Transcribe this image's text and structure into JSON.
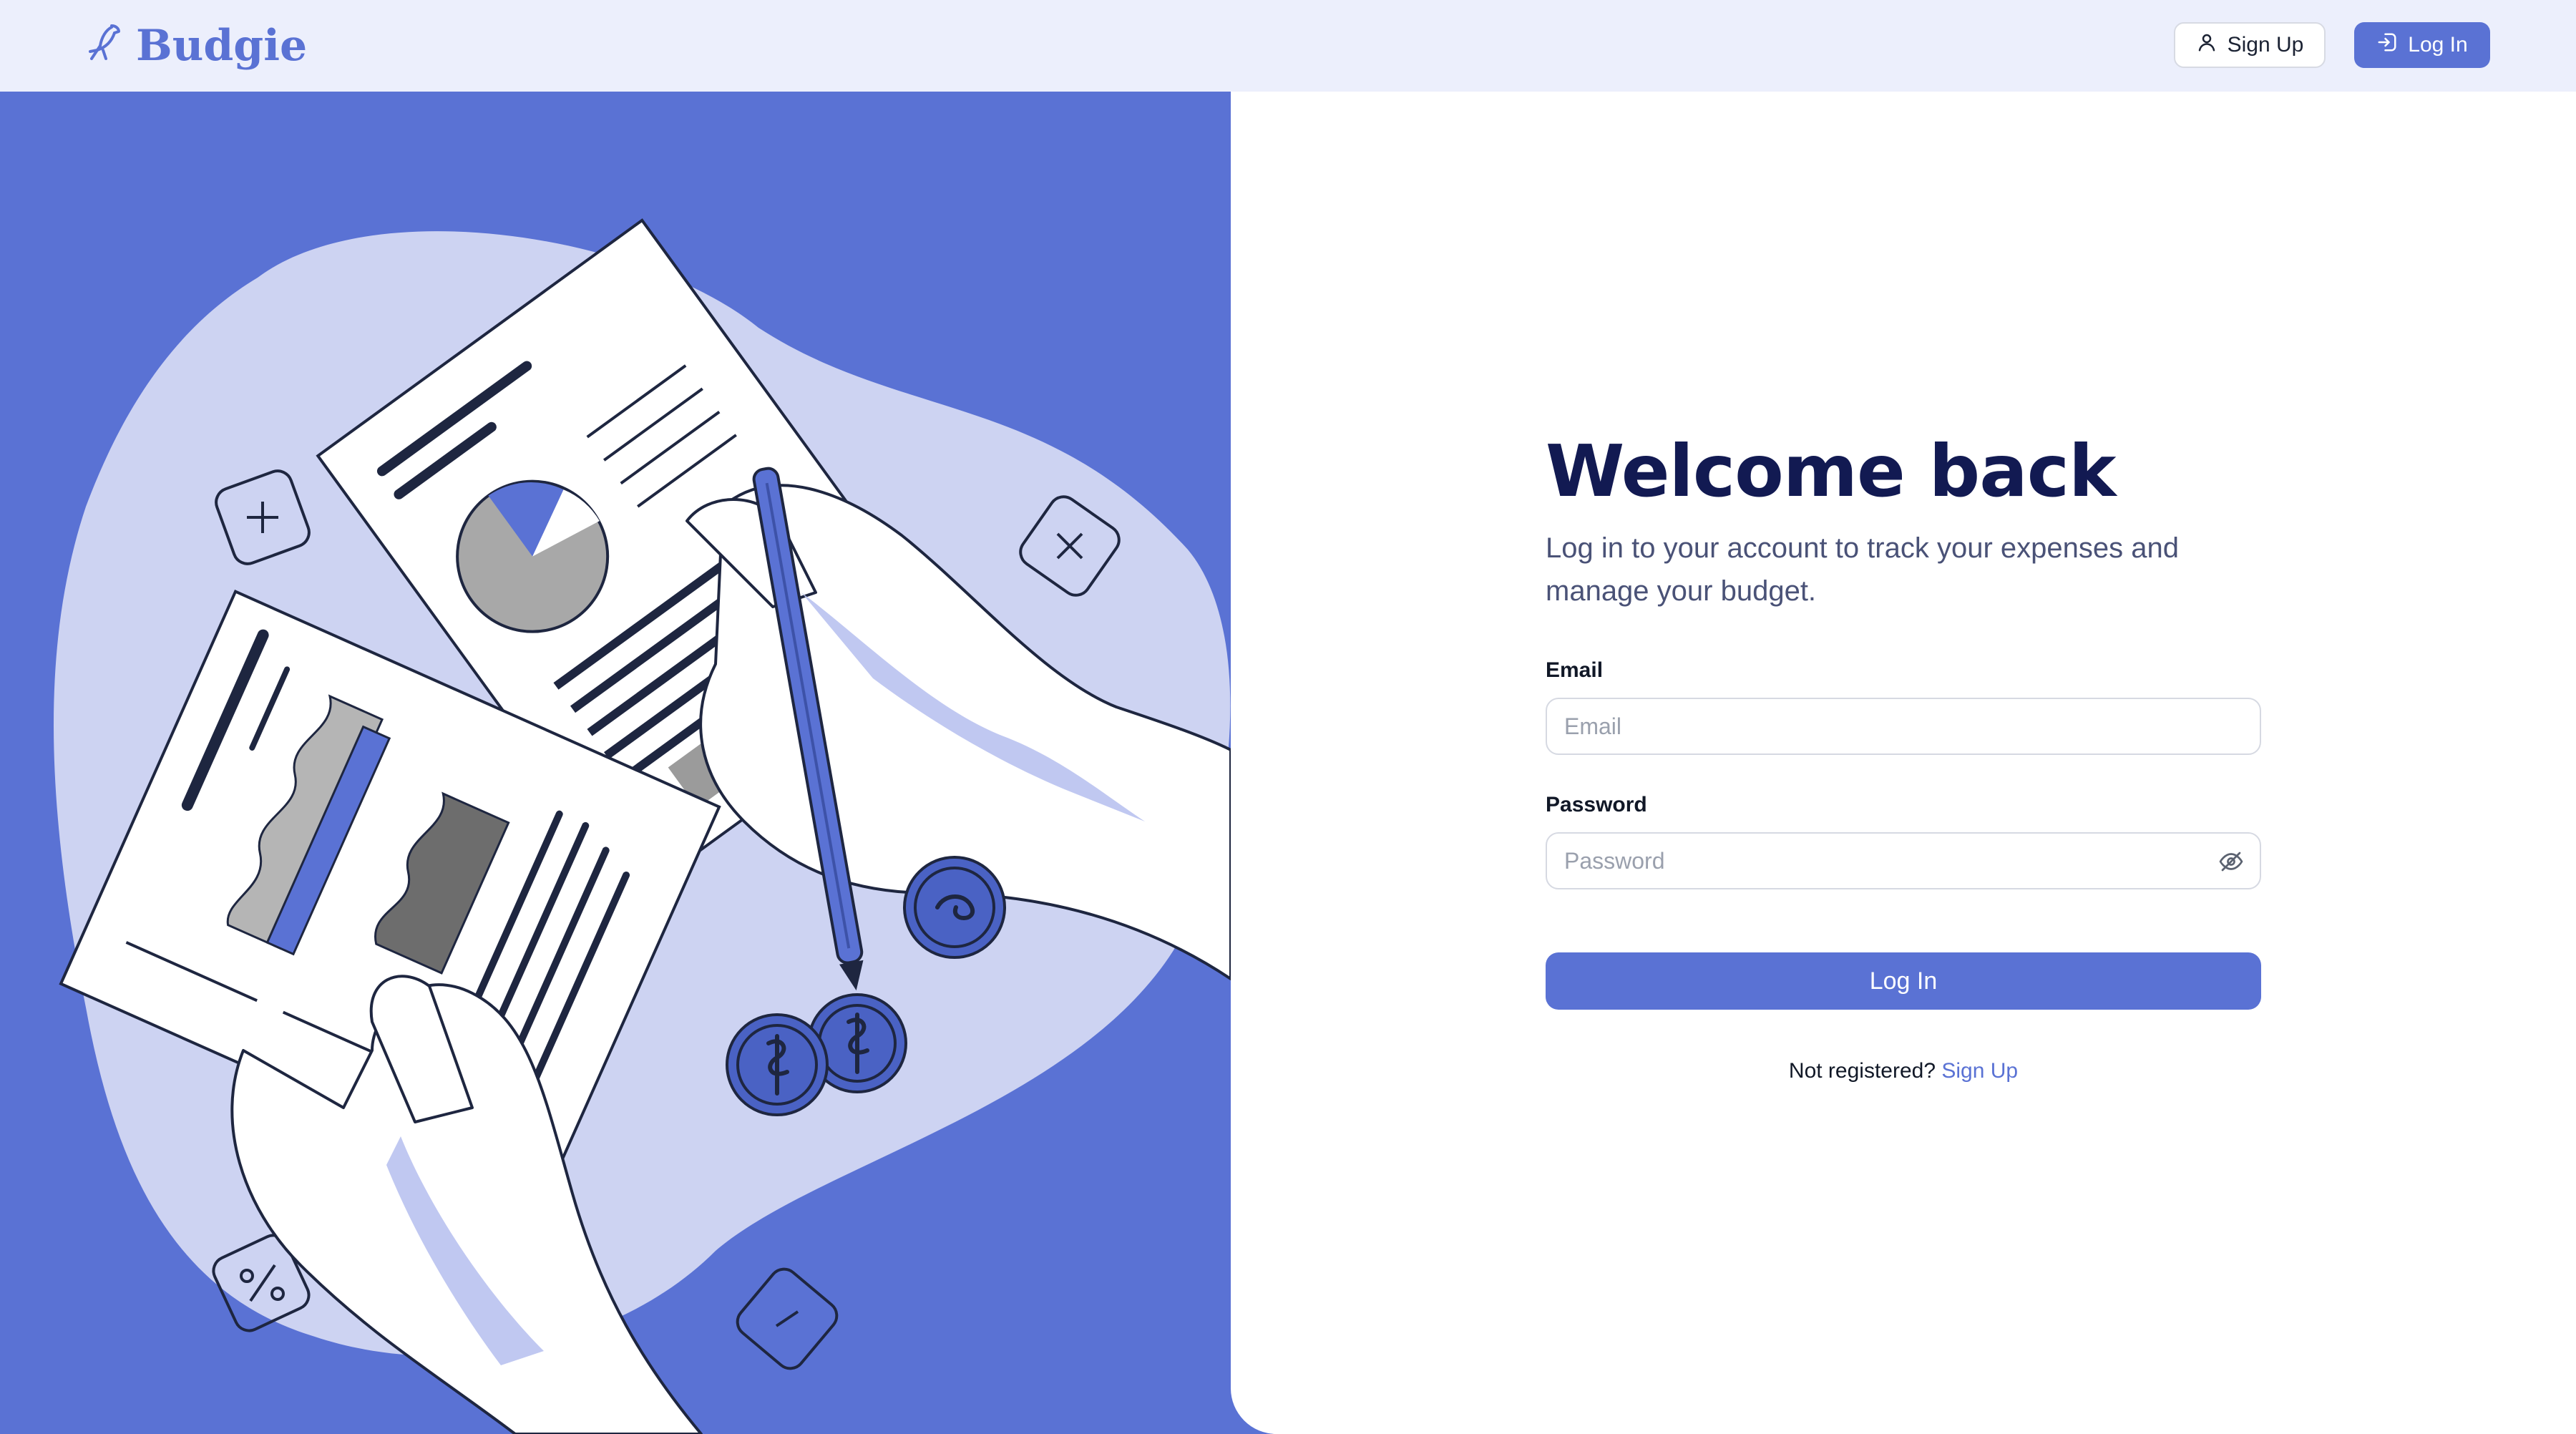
{
  "brand": {
    "name": "Budgie",
    "icon": "budgie-bird-icon"
  },
  "nav": {
    "signup_label": "Sign Up",
    "signup_icon": "user-icon",
    "login_label": "Log In",
    "login_icon": "login-icon"
  },
  "login": {
    "title": "Welcome back",
    "subtitle": "Log in to your account to track your expenses and manage your budget.",
    "email_label": "Email",
    "email_placeholder": "Email",
    "email_value": "",
    "password_label": "Password",
    "password_placeholder": "Password",
    "password_value": "",
    "password_toggle_icon": "eye-off-icon",
    "submit_label": "Log In",
    "footer_prompt": "Not registered?",
    "footer_link": "Sign Up"
  },
  "colors": {
    "accent": "#5a72d4",
    "header_bg": "#eceffc",
    "title": "#121a52",
    "illustration_light": "#cdd3f2"
  }
}
